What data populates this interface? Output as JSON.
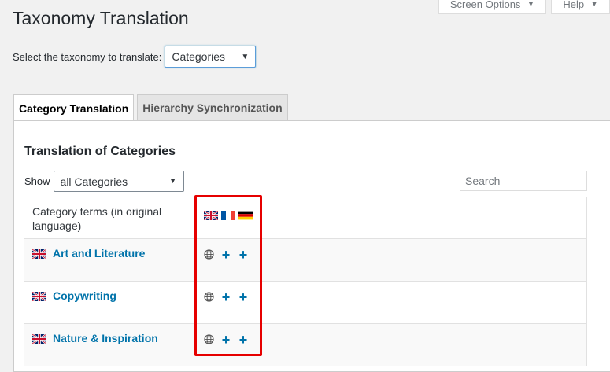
{
  "screen_meta": {
    "screen_options_label": "Screen Options",
    "help_label": "Help",
    "caret": "▼"
  },
  "page": {
    "title": "Taxonomy Translation",
    "select_label": "Select the taxonomy to translate:",
    "taxonomy_selected": "Categories"
  },
  "tabs": [
    {
      "label": "Category Translation",
      "active": true
    },
    {
      "label": "Hierarchy Synchronization",
      "active": false
    }
  ],
  "panel": {
    "title": "Translation of Categories",
    "show_label": "Show",
    "show_selected": "all Categories",
    "search_placeholder": "Search"
  },
  "table": {
    "header_term": "Category terms (in original language)",
    "languages": [
      "english-flag-icon",
      "french-flag-icon",
      "german-flag-icon"
    ],
    "rows": [
      {
        "name": "Art and Literature",
        "flag": "english-flag-icon",
        "actions": [
          "globe-icon",
          "plus-icon",
          "plus-icon"
        ]
      },
      {
        "name": "Copywriting",
        "flag": "english-flag-icon",
        "actions": [
          "globe-icon",
          "plus-icon",
          "plus-icon"
        ]
      },
      {
        "name": "Nature & Inspiration",
        "flag": "english-flag-icon",
        "actions": [
          "globe-icon",
          "plus-icon",
          "plus-icon"
        ]
      }
    ],
    "plus_glyph": "+"
  },
  "colors": {
    "link": "#0073aa",
    "highlight": "#e60000"
  }
}
